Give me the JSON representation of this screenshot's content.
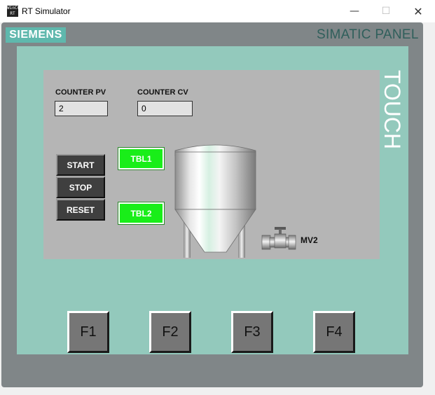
{
  "window": {
    "title": "RT Simulator",
    "icon_text": "WinCC RT",
    "minimize": "—",
    "maximize": "☐",
    "close": "✕"
  },
  "panel": {
    "brand": "SIEMENS",
    "model": "SIMATIC PANEL",
    "touch": "TOUCH",
    "colors": {
      "bezel": "#808688",
      "teal": "#93c9bc",
      "screen": "#b5b5b5",
      "lamp_on": "#19ee19"
    }
  },
  "screen": {
    "counter_pv": {
      "label": "COUNTER PV",
      "value": "2"
    },
    "counter_cv": {
      "label": "COUNTER CV",
      "value": "0"
    },
    "buttons": {
      "start": "START",
      "stop": "STOP",
      "reset": "RESET"
    },
    "lamps": {
      "tbl1": "TBL1",
      "tbl2": "TBL2"
    },
    "tank_icon": "tank-icon",
    "valve_icon": "valve-icon",
    "valve_label": "MV2"
  },
  "function_keys": [
    "F1",
    "F2",
    "F3",
    "F4"
  ]
}
